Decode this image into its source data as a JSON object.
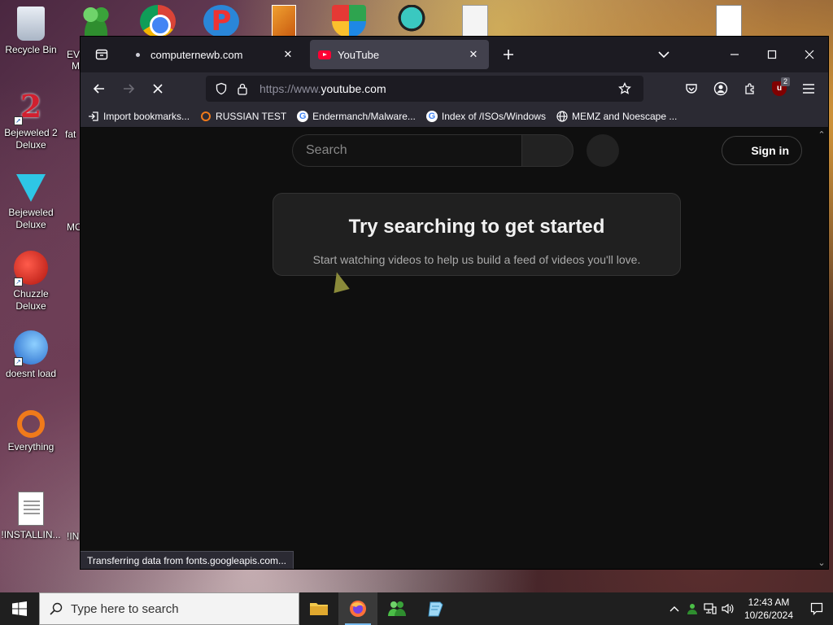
{
  "desktop": {
    "icons": [
      {
        "label": "Recycle Bin"
      },
      {
        "label": "Bejeweled 2 Deluxe"
      },
      {
        "label": "Bejeweled Deluxe"
      },
      {
        "label": "Chuzzle Deluxe"
      },
      {
        "label": "doesnt load"
      },
      {
        "label": "Everything"
      },
      {
        "label": "!INSTALLIN..."
      }
    ],
    "partial_labels": [
      "EV",
      "M",
      "fat",
      "MO",
      "!IN"
    ]
  },
  "browser": {
    "tabs": [
      {
        "title": "computernewb.com",
        "active": false
      },
      {
        "title": "YouTube",
        "active": true
      }
    ],
    "url": {
      "scheme": "https://www.",
      "host": "youtube.com"
    },
    "extension_badge": "2",
    "bookmarks": [
      {
        "label": "Import bookmarks...",
        "icon": "import-icon"
      },
      {
        "label": "RUSSIAN TEST",
        "icon": "ring-icon"
      },
      {
        "label": "Endermanch/Malware...",
        "icon": "google-icon"
      },
      {
        "label": "Index of /ISOs/Windows",
        "icon": "google-icon"
      },
      {
        "label": "MEMZ and Noescape ...",
        "icon": "globe-icon"
      }
    ],
    "status_text": "Transferring data from fonts.googleapis.com..."
  },
  "youtube": {
    "search_placeholder": "Search",
    "signin_label": "Sign in",
    "card_title": "Try searching to get started",
    "card_text": "Start watching videos to help us build a feed of videos you'll love."
  },
  "taskbar": {
    "search_placeholder": "Type here to search",
    "time": "12:43 AM",
    "date": "10/26/2024"
  },
  "colors": {
    "toolbar": "#2b2a33",
    "tabbar": "#1c1b22",
    "active_tab": "#42414d",
    "page_bg": "#0f0f0f",
    "youtube_red": "#ff0033"
  }
}
